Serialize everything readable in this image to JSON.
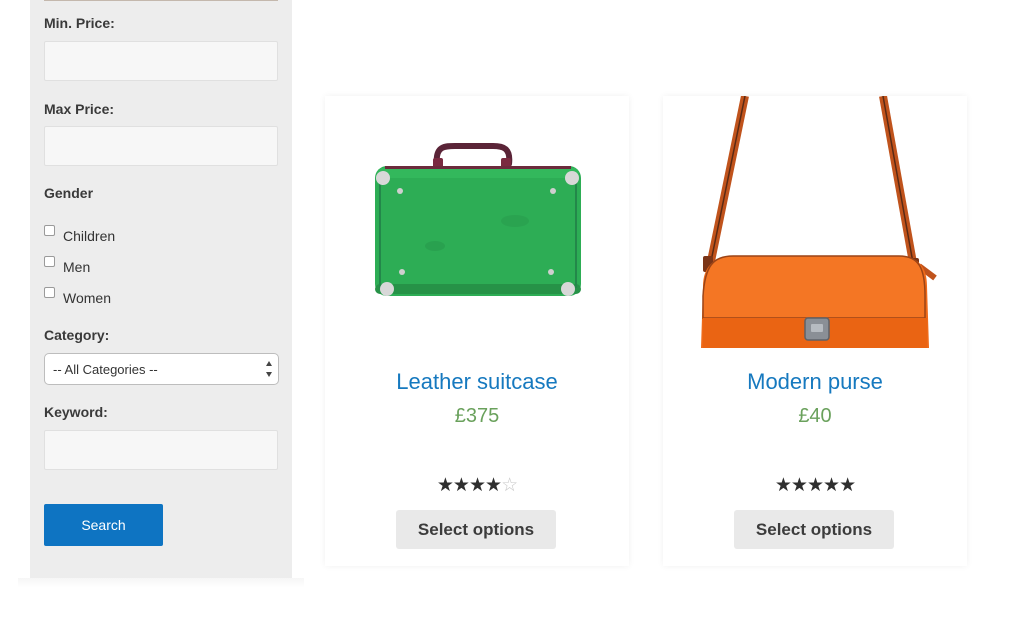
{
  "filters": {
    "min_price_label": "Min. Price:",
    "max_price_label": "Max Price:",
    "gender_label": "Gender",
    "gender_options": [
      "Children",
      "Men",
      "Women"
    ],
    "category_label": "Category:",
    "category_selected": "-- All Categories --",
    "keyword_label": "Keyword:",
    "search_label": "Search"
  },
  "products": [
    {
      "name": "Leather suitcase",
      "price": "£375",
      "rating": 4,
      "rating_max": 5,
      "button_label": "Select options",
      "image": "green-suitcase"
    },
    {
      "name": "Modern purse",
      "price": "£40",
      "rating": 5,
      "rating_max": 5,
      "button_label": "Select options",
      "image": "orange-purse"
    }
  ],
  "colors": {
    "link": "#1679bf",
    "price": "#6aa15c",
    "search_button": "#0e74c2",
    "sidebar_bg": "#ededed"
  }
}
